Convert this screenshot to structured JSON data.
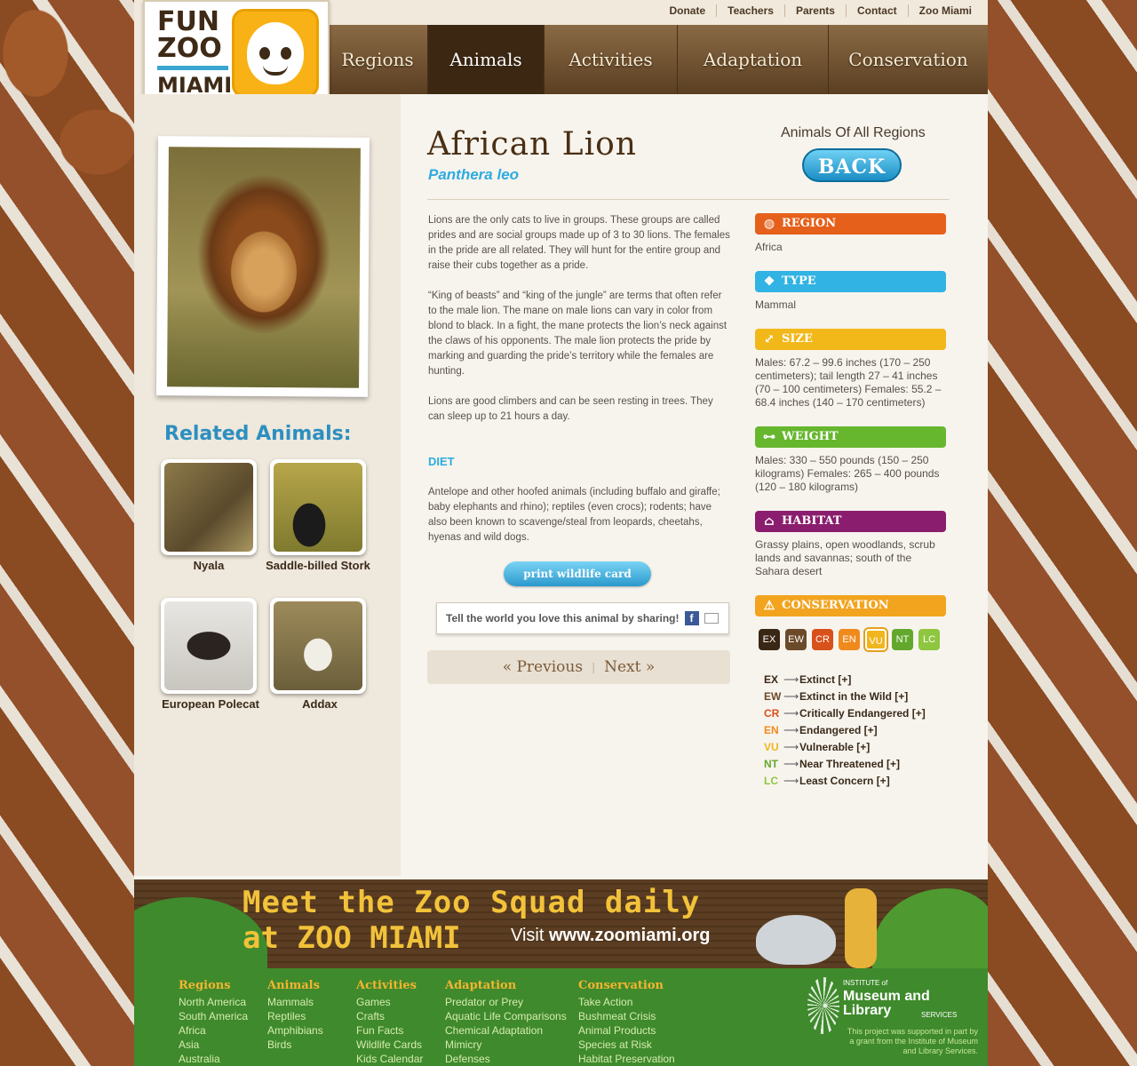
{
  "toplinks": [
    "Donate",
    "Teachers",
    "Parents",
    "Contact",
    "Zoo Miami"
  ],
  "logo": {
    "line1": "FUN",
    "line2": "ZOO",
    "line3": "MIAMI"
  },
  "nav": [
    {
      "label": "Regions"
    },
    {
      "label": "Animals"
    },
    {
      "label": "Activities"
    },
    {
      "label": "Adaptation"
    },
    {
      "label": "Conservation"
    }
  ],
  "animal": {
    "title": "African Lion",
    "scientific": "Panthera leo",
    "paragraphs": [
      "Lions are the only cats to live in groups. These groups are called prides and are social groups made up of 3 to 30 lions. The females in the pride are all related. They will hunt for the entire group and raise their cubs together as a pride.",
      "“King of beasts” and “king of the jungle” are terms that often refer to the male lion. The mane on male lions can vary in color from blond to black. In a fight, the mane protects the lion’s neck against the claws of his opponents. The male lion protects the pride by marking and guarding the pride’s territory while the females are hunting.",
      "Lions are good climbers and can be seen resting in trees. They can sleep up to 21 hours a day."
    ],
    "diet_heading": "DIET",
    "diet": "Antelope and other hoofed animals (including buffalo and giraffe; baby elephants and rhino); reptiles (even crocs); rodents; have also been known to scavenge/steal from leopards, cheetahs, hyenas and wild dogs."
  },
  "back": {
    "caption": "Animals Of All Regions",
    "label": "BACK"
  },
  "print_label": "print wildlife card",
  "share_text": "Tell the world you love this animal by sharing!",
  "pager": {
    "prev": "« Previous",
    "sep": "|",
    "next": "Next »"
  },
  "related": {
    "title": "Related Animals:",
    "items": [
      {
        "name": "Nyala"
      },
      {
        "name": "Saddle-billed Stork"
      },
      {
        "name": "European Polecat"
      },
      {
        "name": "Addax"
      }
    ]
  },
  "info": {
    "region": {
      "label": "REGION",
      "value": "Africa",
      "color": "#e5601b"
    },
    "type": {
      "label": "TYPE",
      "value": "Mammal",
      "color": "#31b3e3"
    },
    "size": {
      "label": "SIZE",
      "value": "Males: 67.2 – 99.6 inches (170 – 250 centimeters); tail length 27 – 41 inches (70 – 100 centimeters) Females: 55.2 – 68.4 inches (140 – 170 centimeters)",
      "color": "#f2b81a"
    },
    "weight": {
      "label": "WEIGHT",
      "value": "Males: 330 – 550 pounds (150 – 250 kilograms) Females: 265 – 400 pounds (120 – 180 kilograms)",
      "color": "#66b72e"
    },
    "habitat": {
      "label": "HABITAT",
      "value": "Grassy plains, open woodlands, scrub lands and savannas; south of the Sahara desert",
      "color": "#8a1d6e"
    },
    "conservation": {
      "label": "CONSERVATION",
      "color": "#f2a41f"
    }
  },
  "conservation_scale": [
    {
      "code": "EX",
      "name": "Extinct [+]",
      "color": "#3a2614"
    },
    {
      "code": "EW",
      "name": "Extinct in the Wild [+]",
      "color": "#6b4a2a"
    },
    {
      "code": "CR",
      "name": "Critically Endangered [+]",
      "color": "#d8501a"
    },
    {
      "code": "EN",
      "name": "Endangered [+]",
      "color": "#f08a1c"
    },
    {
      "code": "VU",
      "name": "Vulnerable [+]",
      "color": "#f1b51d"
    },
    {
      "code": "NT",
      "name": "Near Threatened [+]",
      "color": "#63a82c"
    },
    {
      "code": "LC",
      "name": "Least Concern [+]",
      "color": "#8ec63f"
    }
  ],
  "conservation_selected": "VU",
  "banner": {
    "line1": "Meet the Zoo Squad daily",
    "line2": "at ZOO MIAMI",
    "visit": "Visit",
    "url": "www.zoomiami.org"
  },
  "footer": {
    "columns": [
      {
        "title": "Regions",
        "links": [
          "North America",
          "South America",
          "Africa",
          "Asia",
          "Australia"
        ]
      },
      {
        "title": "Animals",
        "links": [
          "Mammals",
          "Reptiles",
          "Amphibians",
          "Birds"
        ]
      },
      {
        "title": "Activities",
        "links": [
          "Games",
          "Crafts",
          "Fun Facts",
          "Wildlife Cards",
          "Kids Calendar"
        ]
      },
      {
        "title": "Adaptation",
        "links": [
          "Predator or Prey",
          "Aquatic Life Comparisons",
          "Chemical Adaptation",
          "Mimicry",
          "Defenses"
        ]
      },
      {
        "title": "Conservation",
        "links": [
          "Take Action",
          "Bushmeat Crisis",
          "Animal Products",
          "Species at Risk",
          "Habitat Preservation"
        ]
      }
    ],
    "imls": {
      "small": "INSTITUTE of",
      "big": "Museum and Library",
      "services": "SERVICES",
      "note": "This project was supported in part by a grant from the Institute of Museum and Library Services."
    }
  }
}
